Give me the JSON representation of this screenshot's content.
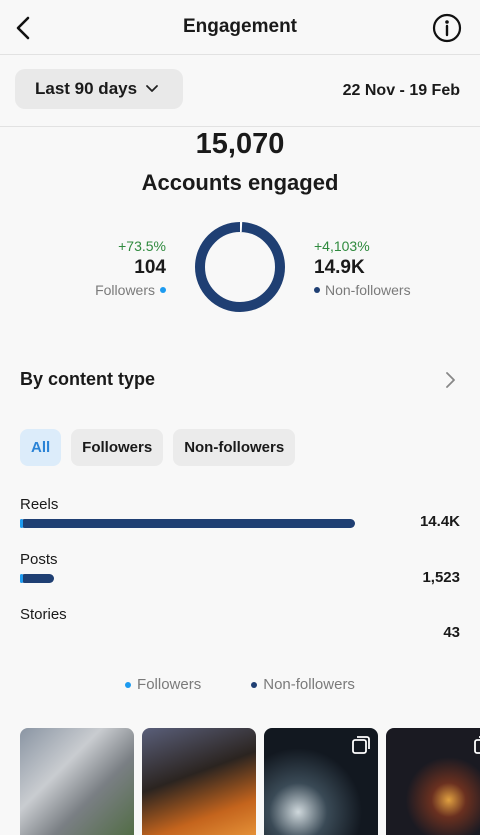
{
  "header": {
    "title": "Engagement"
  },
  "filters": {
    "range_label": "Last 90 days",
    "date_range": "22 Nov - 19 Feb"
  },
  "summary": {
    "total": "15,070",
    "label": "Accounts engaged"
  },
  "followers": {
    "change": "+73.5%",
    "value": "104",
    "label": "Followers"
  },
  "non_followers": {
    "change": "+4,103%",
    "value": "14.9K",
    "label": "Non-followers"
  },
  "by_content": {
    "title": "By content type",
    "chips": [
      "All",
      "Followers",
      "Non-followers"
    ],
    "rows": [
      {
        "label": "Reels",
        "value": "14.4K"
      },
      {
        "label": "Posts",
        "value": "1,523"
      },
      {
        "label": "Stories",
        "value": "43"
      }
    ]
  },
  "legend": {
    "followers": "Followers",
    "non_followers": "Non-followers"
  },
  "colors": {
    "followers": "#1d9bf0",
    "non_followers": "#1f3f73",
    "positive": "#2f8a3e"
  },
  "chart_data": {
    "type": "bar",
    "categories": [
      "Reels",
      "Posts",
      "Stories"
    ],
    "series": [
      {
        "name": "Followers",
        "values": [
          0.01,
          0.01,
          0
        ]
      },
      {
        "name": "Non-followers",
        "values": [
          1.0,
          0.1,
          0.003
        ]
      }
    ],
    "donut": {
      "followers_share": 0.007,
      "non_followers_share": 0.993
    }
  },
  "thumbnails": [
    {
      "icon": ""
    },
    {
      "icon": ""
    },
    {
      "icon": "multi-photo-icon"
    },
    {
      "icon": "multi-photo-icon"
    }
  ]
}
